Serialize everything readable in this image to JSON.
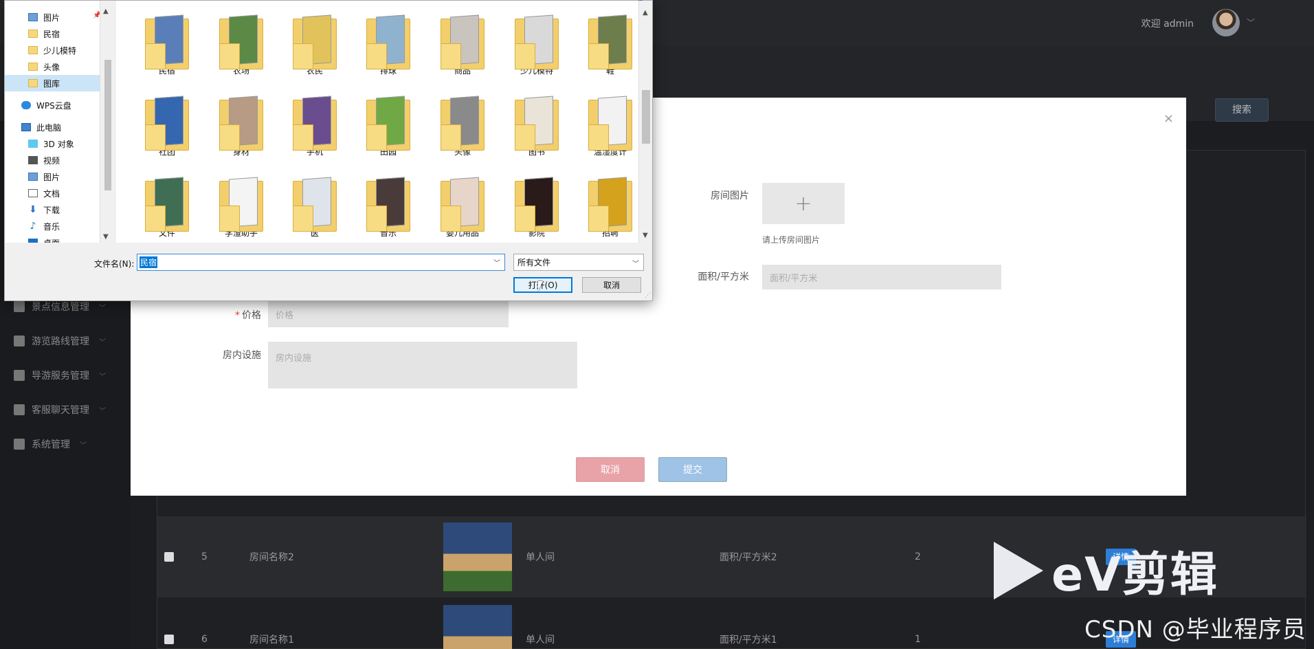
{
  "header": {
    "welcome": "欢迎 admin"
  },
  "toolbar": {
    "search_label": "搜索"
  },
  "sidebar": {
    "items": [
      {
        "label": "景点信息管理"
      },
      {
        "label": "游览路线管理"
      },
      {
        "label": "导游服务管理"
      },
      {
        "label": "客服聊天管理"
      },
      {
        "label": "系统管理"
      }
    ]
  },
  "table": {
    "rows": [
      {
        "id": "5",
        "name": "房间名称2",
        "type": "单人间",
        "area": "面积/平方米2",
        "num": "2",
        "action": "详情"
      },
      {
        "id": "6",
        "name": "房间名称1",
        "type": "单人间",
        "area": "面积/平方米1",
        "num": "1",
        "action": "详情"
      }
    ]
  },
  "modal": {
    "room_image_label": "房间图片",
    "upload_plus": "+",
    "upload_hint": "请上传房间图片",
    "area_label": "面积/平方米",
    "area_placeholder": "面积/平方米",
    "price_required": "*",
    "price_label": "价格",
    "price_placeholder": "价格",
    "facilities_label": "房内设施",
    "facilities_placeholder": "房内设施",
    "cancel_label": "取消",
    "submit_label": "提交",
    "close_glyph": "×"
  },
  "file_dialog": {
    "nav_items": [
      {
        "label": "图片",
        "icon": "picture-icon"
      },
      {
        "label": "民宿",
        "icon": "folder-icon"
      },
      {
        "label": "少儿模特",
        "icon": "folder-icon"
      },
      {
        "label": "头像",
        "icon": "folder-icon"
      },
      {
        "label": "图库",
        "icon": "folder-icon",
        "selected": true
      },
      {
        "label": "WPS云盘",
        "icon": "cloud-icon"
      },
      {
        "label": "此电脑",
        "icon": "computer-icon"
      },
      {
        "label": "3D 对象",
        "icon": "3d-objects-icon"
      },
      {
        "label": "视频",
        "icon": "video-icon"
      },
      {
        "label": "图片",
        "icon": "picture-icon"
      },
      {
        "label": "文档",
        "icon": "document-icon"
      },
      {
        "label": "下载",
        "icon": "download-icon"
      },
      {
        "label": "音乐",
        "icon": "music-icon"
      },
      {
        "label": "桌面",
        "icon": "desktop-icon"
      }
    ],
    "folders": [
      {
        "label": "民宿",
        "color": "#5a7fb8"
      },
      {
        "label": "农场",
        "color": "#5c8a46"
      },
      {
        "label": "农民",
        "color": "#e2c35b"
      },
      {
        "label": "排球",
        "color": "#8fb3cf"
      },
      {
        "label": "商品",
        "color": "#c9c4be"
      },
      {
        "label": "少儿模特",
        "color": "#d9d9d9"
      },
      {
        "label": "鞋",
        "color": "#6d7d4b"
      },
      {
        "label": "社团",
        "color": "#3566b0"
      },
      {
        "label": "身材",
        "color": "#b79b85"
      },
      {
        "label": "手机",
        "color": "#6a4d8e"
      },
      {
        "label": "田园",
        "color": "#6fa845"
      },
      {
        "label": "头像",
        "color": "#8a8a8a"
      },
      {
        "label": "图书",
        "color": "#e9e3d8"
      },
      {
        "label": "温湿度计",
        "color": "#f2f2f2"
      },
      {
        "label": "文件",
        "color": "#3f6e55"
      },
      {
        "label": "学渣助手",
        "color": "#f4f4f4"
      },
      {
        "label": "医",
        "color": "#dfe4ea"
      },
      {
        "label": "音乐",
        "color": "#4a3b3b"
      },
      {
        "label": "婴儿用品",
        "color": "#e8d5c9"
      },
      {
        "label": "影院",
        "color": "#2a1a1a"
      },
      {
        "label": "招聘",
        "color": "#d4a21c"
      }
    ],
    "filename_label": "文件名(N):",
    "filename_value": "民宿",
    "filetype_value": "所有文件",
    "open_label": "打开(O)",
    "cancel_label": "取消"
  },
  "watermark": {
    "ev": "eV剪辑",
    "csdn": "CSDN @毕业程序员"
  }
}
